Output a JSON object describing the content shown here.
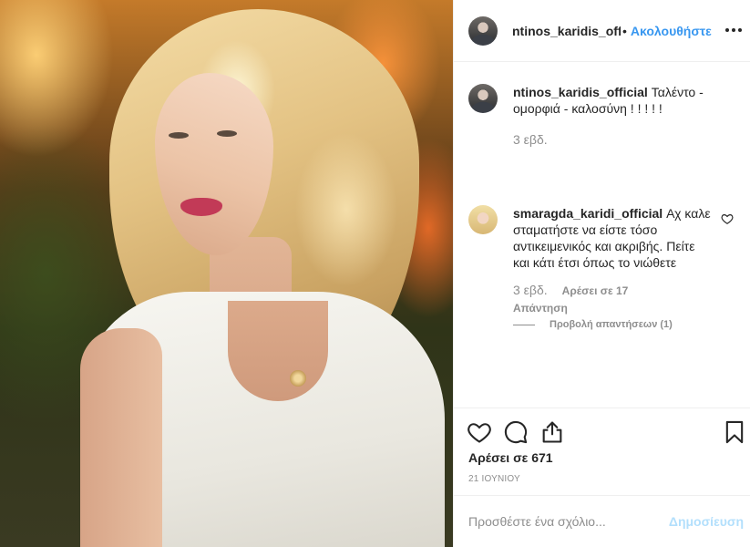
{
  "header": {
    "username": "ntinos_karidis_official",
    "separator": "•",
    "follow_label": "Ακολουθήστε",
    "more_icon": "more-horizontal-icon"
  },
  "caption": {
    "username": "ntinos_karidis_official",
    "text": "Ταλέντο - ομορφιά - καλοσύνη ! ! ! ! !",
    "time": "3 εβδ."
  },
  "comments": [
    {
      "username": "smaragda_karidi_official",
      "text": "Αχ καλε σταματήστε να είστε τόσο αντικειμενικός και ακριβής. Πείτε και κάτι έτσι όπως το νιώθετε",
      "time": "3 εβδ.",
      "likes": "Αρέσει σε 17",
      "reply_label": "Απάντηση",
      "view_replies": "Προβολή απαντήσεων (1)"
    }
  ],
  "post": {
    "likes": "Αρέσει σε 671",
    "date": "21 ΙΟΥΝΙΟΥ"
  },
  "add_comment": {
    "placeholder": "Προσθέστε ένα σχόλιο...",
    "post_label": "Δημοσίευση"
  },
  "colors": {
    "link": "#3897f0",
    "post_disabled": "#b2dffc",
    "secondary_text": "#8e8e8e"
  }
}
